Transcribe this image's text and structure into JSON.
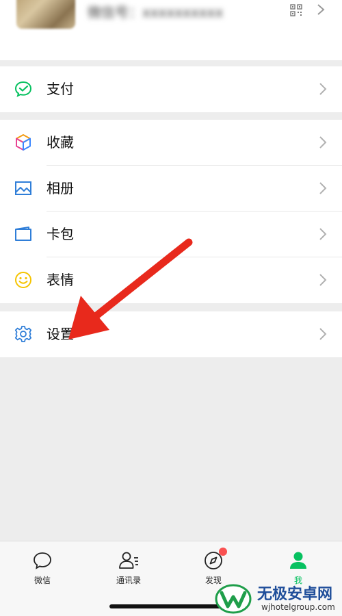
{
  "profile": {
    "name": "微信号：xxxxxxxxxx",
    "chevron": "chevron-right-icon",
    "qr": "qr-code-icon"
  },
  "menu": {
    "pay": {
      "label": "支付",
      "icon": "pay-icon",
      "color": "#07c160"
    },
    "favorites": {
      "label": "收藏",
      "icon": "favorites-cube-icon"
    },
    "album": {
      "label": "相册",
      "icon": "album-icon",
      "color": "#2f7ed8"
    },
    "cards": {
      "label": "卡包",
      "icon": "card-wallet-icon",
      "color": "#2f7ed8"
    },
    "stickers": {
      "label": "表情",
      "icon": "smiley-icon",
      "color": "#f5c400"
    },
    "settings": {
      "label": "设置",
      "icon": "gear-icon",
      "color": "#2f7ed8"
    }
  },
  "tabbar": {
    "chats": "微信",
    "contacts": "通讯录",
    "discover": "发现",
    "me": "我",
    "active_color": "#07c160"
  },
  "annotation": {
    "arrow_color": "#e8291c",
    "target": "settings"
  },
  "watermark": {
    "title": "无极安卓网",
    "url": "wjhotelgroup.com"
  }
}
